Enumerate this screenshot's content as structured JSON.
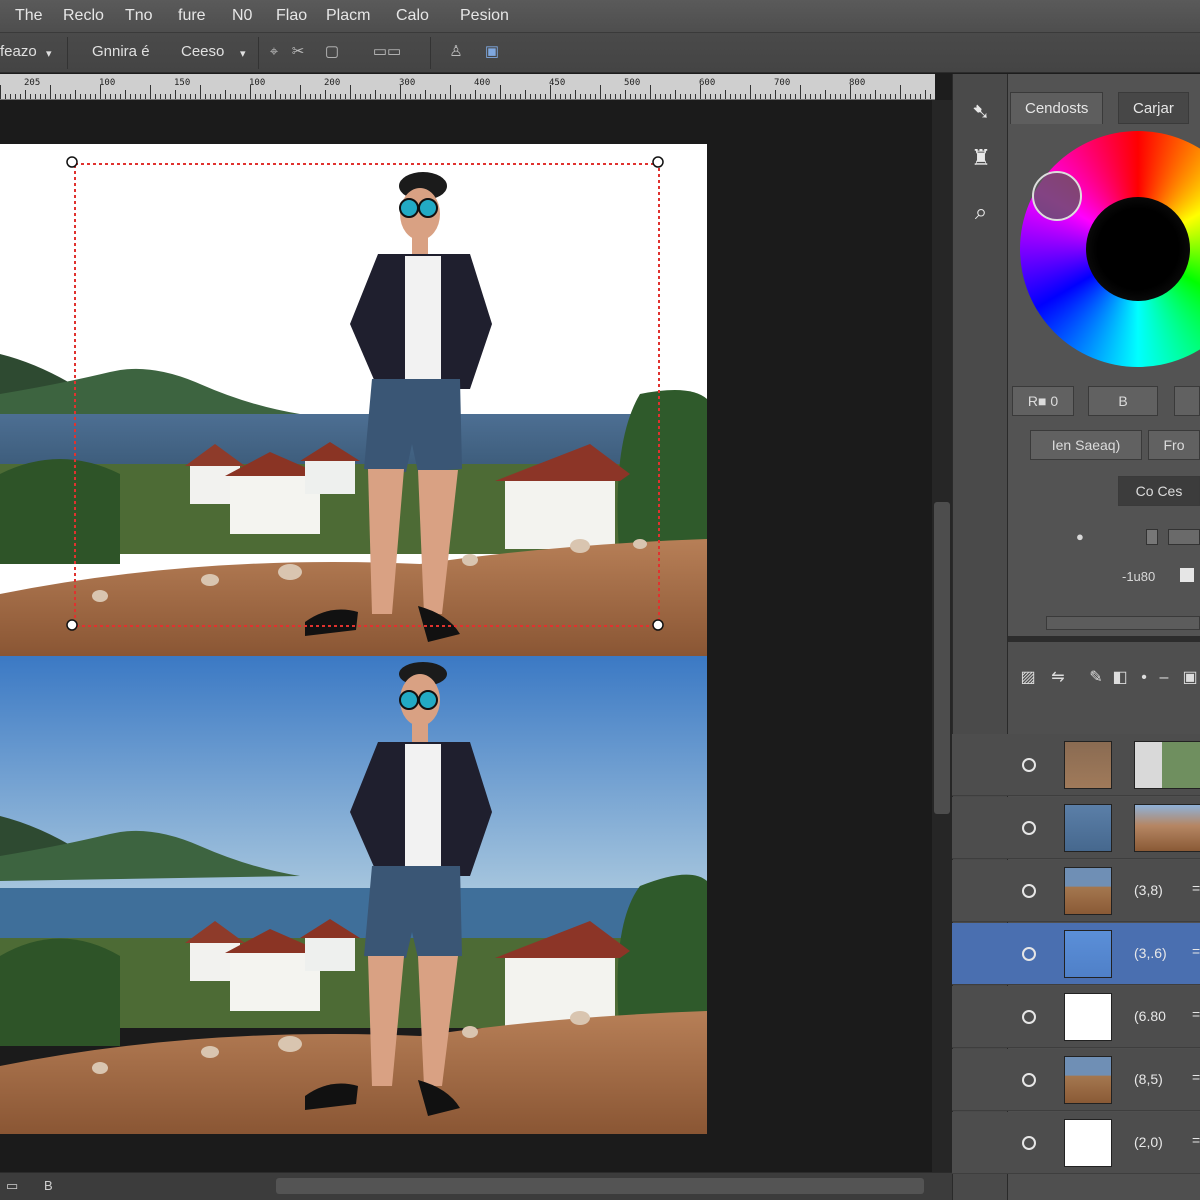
{
  "menu": [
    "The",
    "Reclo",
    "Tno",
    "fure",
    "N0",
    "Flao",
    "Placm",
    "Calo",
    "Pesion"
  ],
  "options": {
    "preset": "feazo",
    "preset_arrow": "▾",
    "mode_a": "Gnnira é",
    "mode_b": "Ceeso",
    "mode_b_arrow": "▾"
  },
  "ruler_labels": [
    "205",
    "100",
    "150",
    "100",
    "200",
    "300",
    "400",
    "450",
    "500",
    "600",
    "700",
    "800"
  ],
  "panels": {
    "color": {
      "tabs": [
        "Cendosts",
        "Carjar"
      ],
      "btn_a": "R■ 0",
      "btn_b": "B",
      "btn_c": "Ien Saeaq)",
      "btn_d": "Fro",
      "btn_e": "Co Ces",
      "label_a": "-1u80"
    },
    "layers": {
      "rows": [
        {
          "value": "",
          "selected": false,
          "thumb": "photo-people"
        },
        {
          "value": "",
          "selected": false,
          "thumb": "blue-gravel"
        },
        {
          "value": "(3,8)",
          "selected": false,
          "thumb": "scene"
        },
        {
          "value": "(3,.6)",
          "selected": true,
          "thumb": "blue"
        },
        {
          "value": "(6.80",
          "selected": false,
          "thumb": "white"
        },
        {
          "value": "(8,5)",
          "selected": false,
          "thumb": "scene"
        },
        {
          "value": "(2,0)",
          "selected": false,
          "thumb": "white"
        }
      ],
      "eq": "="
    }
  },
  "status": {
    "zoom": "B"
  },
  "colors": {
    "accent": "#4a6fb0",
    "selection": "#e0322f"
  }
}
